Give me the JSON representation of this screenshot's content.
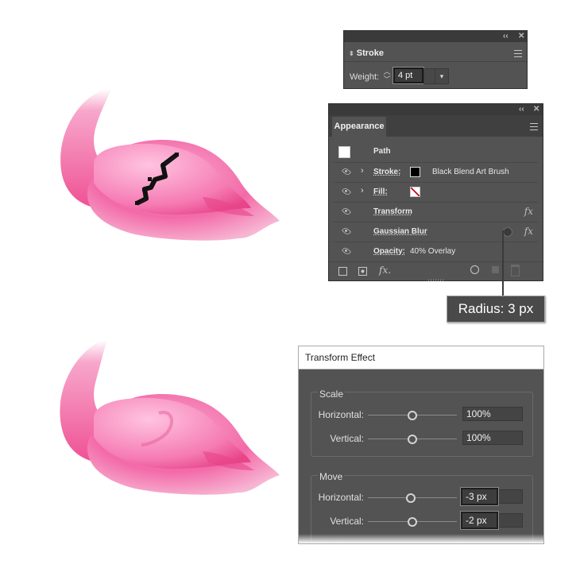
{
  "stroke_panel": {
    "tab": "Stroke",
    "weight_label": "Weight:",
    "weight_value": "4 pt"
  },
  "appearance_panel": {
    "tab": "Appearance",
    "path_label": "Path",
    "rows": [
      {
        "label": "Stroke:",
        "value": "Black Blend Art Brush"
      },
      {
        "label": "Fill:"
      },
      {
        "label": "Transform"
      },
      {
        "label": "Gaussian Blur"
      },
      {
        "label": "Opacity:",
        "value": "40% Overlay"
      }
    ],
    "fx_symbol": "fx"
  },
  "tooltip": "Radius: 3 px",
  "transform_effect": {
    "title": "Transform Effect",
    "scale": {
      "title": "Scale",
      "horizontal_label": "Horizontal:",
      "horizontal_value": "100%",
      "vertical_label": "Vertical:",
      "vertical_value": "100%"
    },
    "move": {
      "title": "Move",
      "horizontal_label": "Horizontal:",
      "horizontal_value": "-3 px",
      "vertical_label": "Vertical:",
      "vertical_value": "-2 px"
    }
  },
  "colors": {
    "panel_bg": "#535353",
    "flamingo_pink": "#f0559a",
    "flamingo_light": "#ff9ccc"
  }
}
